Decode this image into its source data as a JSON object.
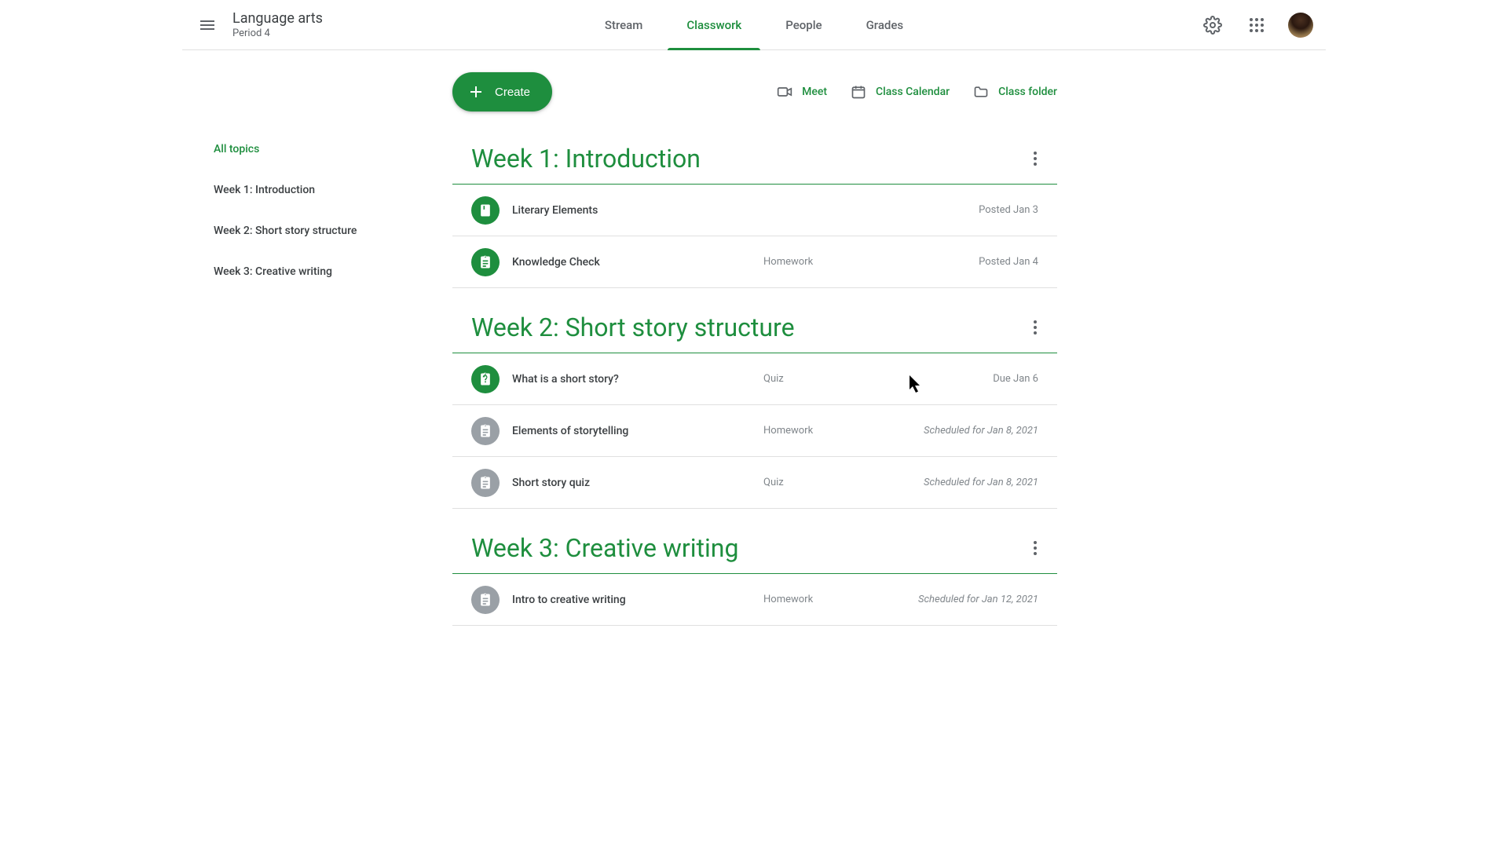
{
  "header": {
    "class_title": "Language arts",
    "class_sub": "Period 4",
    "tabs": [
      {
        "label": "Stream",
        "active": false
      },
      {
        "label": "Classwork",
        "active": true
      },
      {
        "label": "People",
        "active": false
      },
      {
        "label": "Grades",
        "active": false
      }
    ]
  },
  "action": {
    "create_label": "Create",
    "links": [
      {
        "label": "Meet",
        "icon": "video"
      },
      {
        "label": "Class Calendar",
        "icon": "calendar"
      },
      {
        "label": "Class folder",
        "icon": "folder"
      }
    ]
  },
  "sidebar": {
    "items": [
      {
        "label": "All topics",
        "active": true
      },
      {
        "label": "Week 1: Introduction",
        "active": false
      },
      {
        "label": "Week 2: Short story structure",
        "active": false
      },
      {
        "label": "Week 3: Creative writing",
        "active": false
      }
    ]
  },
  "topics": [
    {
      "title": "Week 1: Introduction",
      "items": [
        {
          "title": "Literary Elements",
          "type": "",
          "date": "Posted Jan 3",
          "icon": "material",
          "color": "green",
          "scheduled": false
        },
        {
          "title": "Knowledge Check",
          "type": "Homework",
          "date": "Posted Jan 4",
          "icon": "assignment",
          "color": "green",
          "scheduled": false
        }
      ]
    },
    {
      "title": "Week 2: Short story structure",
      "items": [
        {
          "title": "What is a short story?",
          "type": "Quiz",
          "date": "Due Jan 6",
          "icon": "quiz",
          "color": "green",
          "scheduled": false
        },
        {
          "title": "Elements of storytelling",
          "type": "Homework",
          "date": "Scheduled for Jan 8, 2021",
          "icon": "assignment",
          "color": "gray",
          "scheduled": true
        },
        {
          "title": "Short story quiz",
          "type": "Quiz",
          "date": "Scheduled for Jan 8, 2021",
          "icon": "assignment",
          "color": "gray",
          "scheduled": true
        }
      ]
    },
    {
      "title": "Week 3: Creative writing",
      "items": [
        {
          "title": "Intro to creative writing",
          "type": "Homework",
          "date": "Scheduled for Jan 12, 2021",
          "icon": "assignment",
          "color": "gray",
          "scheduled": true
        }
      ]
    }
  ]
}
